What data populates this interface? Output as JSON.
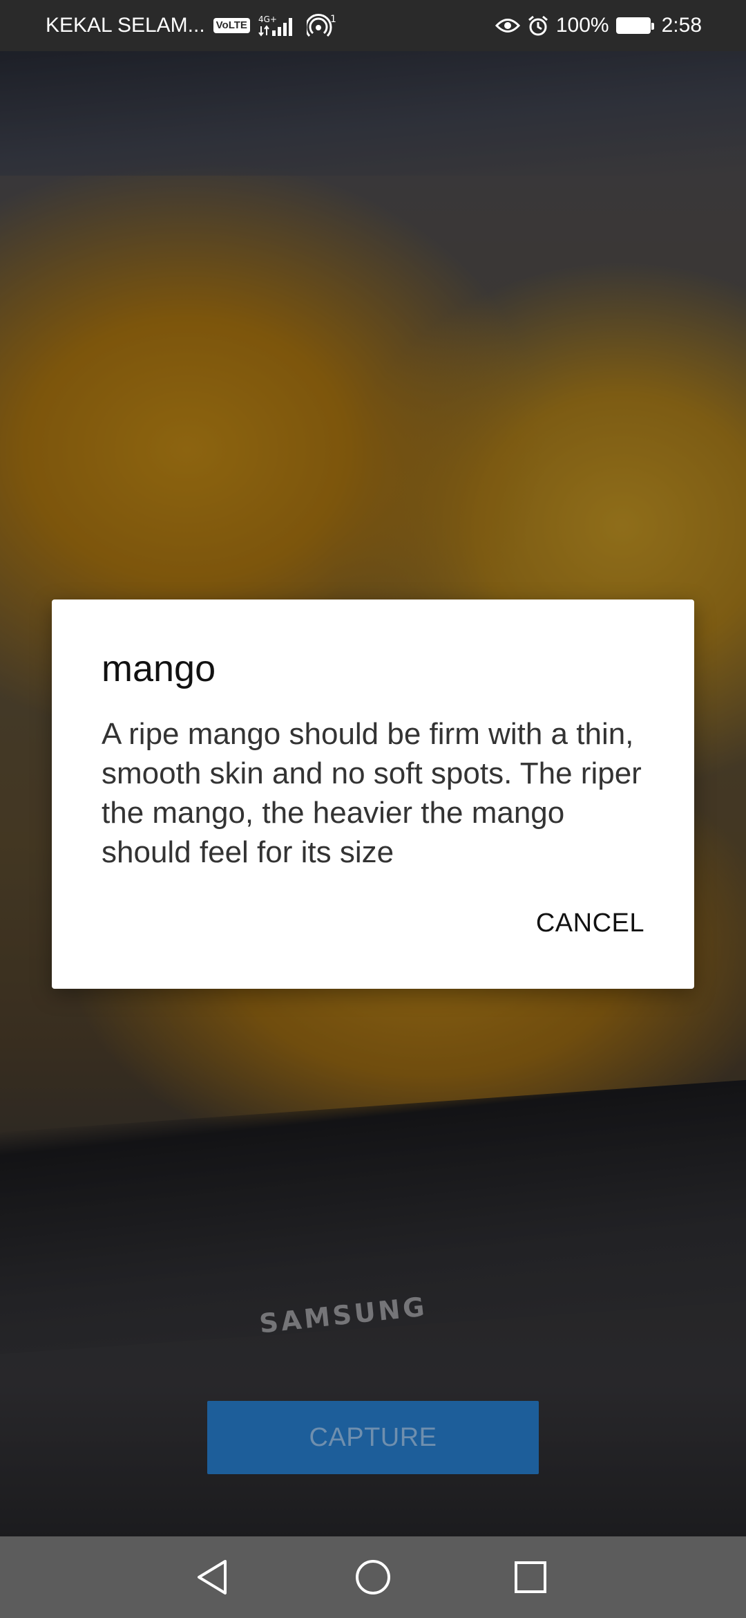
{
  "status_bar": {
    "carrier": "KEKAL SELAM...",
    "volte": "VoLTE",
    "network_type": "4G+",
    "hotspot_count": "1",
    "battery_percent": "100%",
    "time": "2:58",
    "icons": [
      "volte-icon",
      "signal-icon",
      "hotspot-icon",
      "eye-comfort-icon",
      "alarm-icon",
      "battery-icon"
    ]
  },
  "camera": {
    "brand_text": "SAMSUNG"
  },
  "dialog": {
    "title": "mango",
    "message": "A ripe mango should be firm with a thin, smooth skin and no soft spots. The riper the mango, the heavier the mango should feel for its size",
    "cancel_label": "CANCEL"
  },
  "capture": {
    "label": "CAPTURE",
    "color": "#1d5e9a"
  },
  "nav_bar": {
    "items": [
      "back-icon",
      "home-icon",
      "recents-icon"
    ]
  }
}
